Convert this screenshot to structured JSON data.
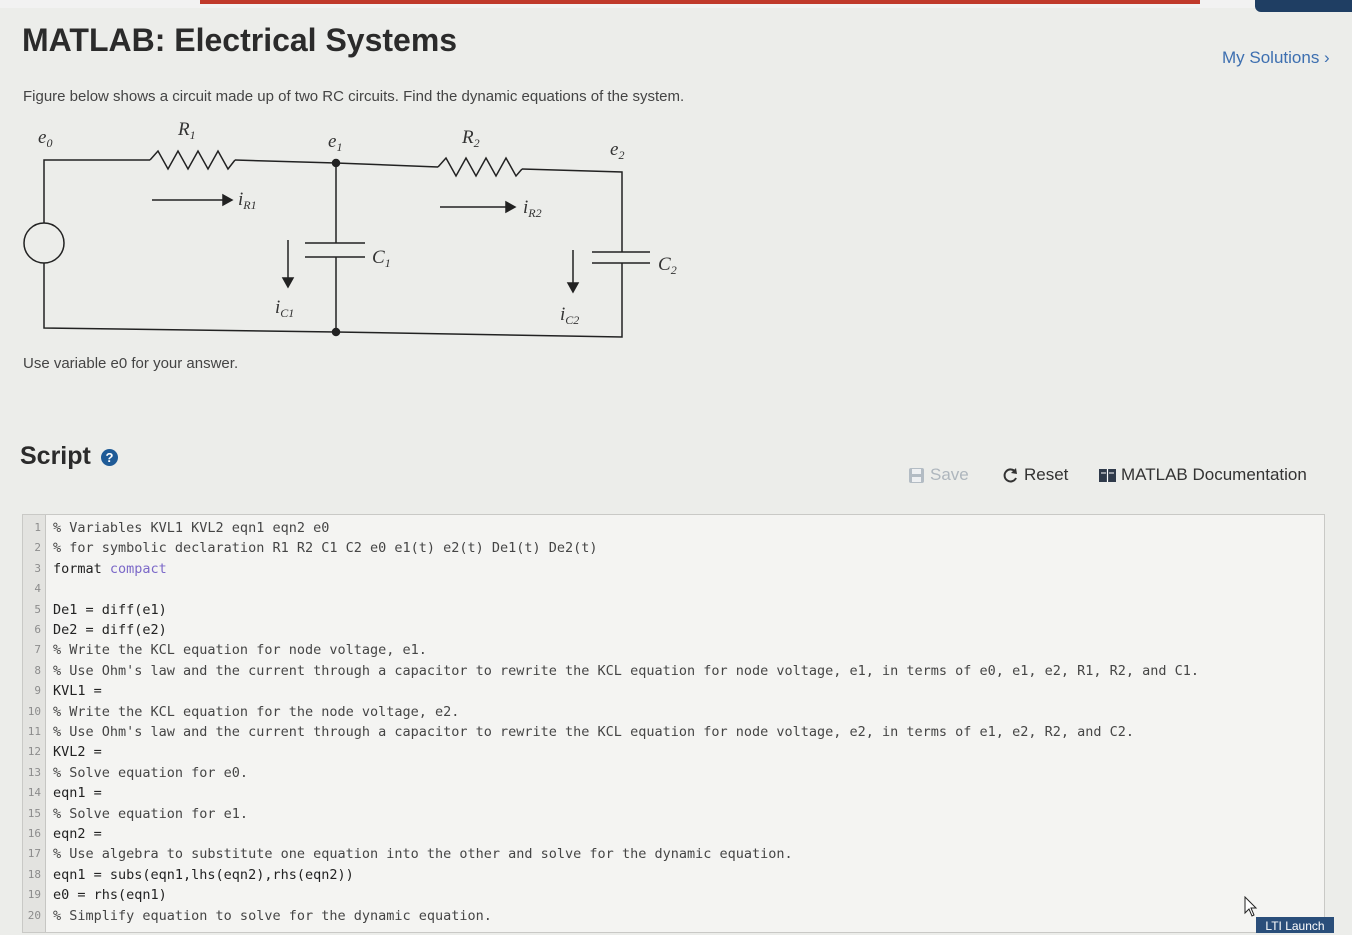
{
  "page": {
    "title": "MATLAB: Electrical Systems",
    "my_solutions": "My Solutions ›",
    "description": "Figure below shows a circuit made up of two RC circuits. Find the dynamic equations of the system.",
    "hint": "Use variable e0 for your answer."
  },
  "circuit": {
    "labels": {
      "e0": "e",
      "e0_sub": "0",
      "e1": "e",
      "e1_sub": "1",
      "e2": "e",
      "e2_sub": "2",
      "r1": "R",
      "r1_sub": "1",
      "r2": "R",
      "r2_sub": "2",
      "c1": "C",
      "c1_sub": "1",
      "c2": "C",
      "c2_sub": "2",
      "ir1": "i",
      "ir1_sub": "R1",
      "ir2": "i",
      "ir2_sub": "R2",
      "ic1": "i",
      "ic1_sub": "C1",
      "ic2": "i",
      "ic2_sub": "C2"
    }
  },
  "script": {
    "heading": "Script",
    "help_icon": "?",
    "toolbar": {
      "save": "Save",
      "reset": "Reset",
      "docs": "MATLAB Documentation"
    },
    "lines": [
      "% Variables KVL1 KVL2 eqn1 eqn2 e0",
      "% for symbolic declaration R1 R2 C1 C2 e0 e1(t) e2(t) De1(t) De2(t)",
      "format compact",
      "",
      "De1 = diff(e1)",
      "De2 = diff(e2)",
      "% Write the KCL equation for node voltage, e1.",
      "% Use Ohm's law and the current through a capacitor to rewrite the KCL equation for node voltage, e1, in terms of e0, e1, e2, R1, R2, and C1.",
      "KVL1 =",
      "% Write the KCL equation for the node voltage, e2.",
      "% Use Ohm's law and the current through a capacitor to rewrite the KCL equation for node voltage, e2, in terms of e1, e2, R2, and C2.",
      "KVL2 =",
      "% Solve equation for e0.",
      "eqn1 =",
      "% Solve equation for e1.",
      "eqn2 =",
      "% Use algebra to substitute one equation into the other and solve for the dynamic equation.",
      "eqn1 = subs(eqn1,lhs(eqn2),rhs(eqn2))",
      "e0 = rhs(eqn1)",
      "% Simplify equation to solve for the dynamic equation."
    ]
  },
  "lti_launch": "LTI Launch",
  "colors": {
    "link": "#3d6fb0",
    "accent": "#1f5b97",
    "keyword_string": "#7b68c8"
  }
}
